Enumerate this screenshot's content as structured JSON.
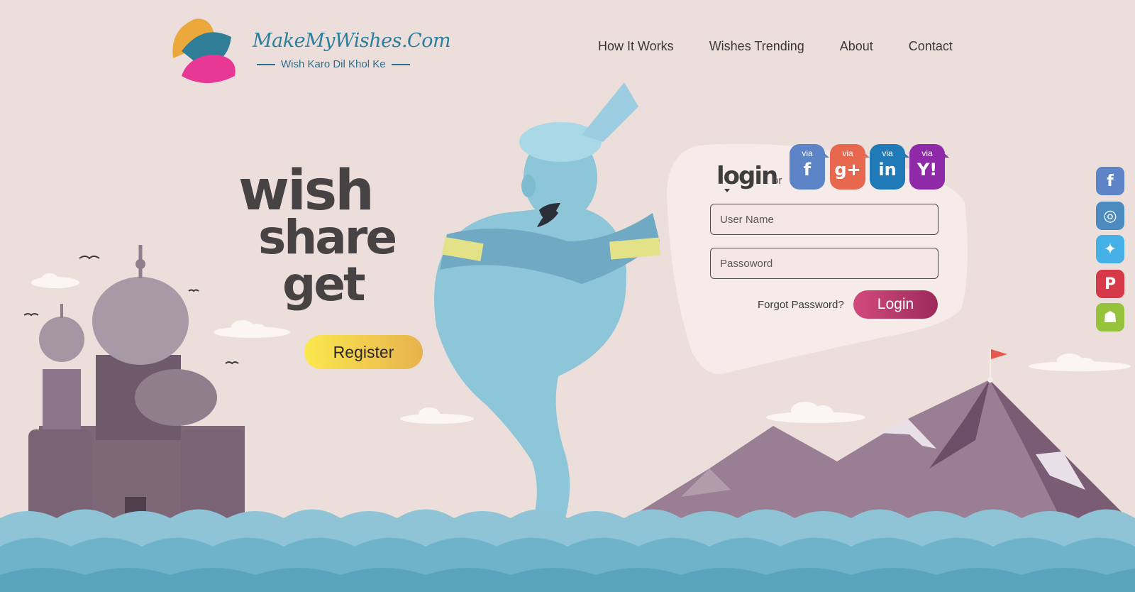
{
  "brand": {
    "title": "MakeMyWishes.Com",
    "tagline": "Wish Karo Dil Khol Ke"
  },
  "nav": {
    "items": [
      "How It Works",
      "Wishes Trending",
      "About",
      "Contact"
    ]
  },
  "hero": {
    "line1": "wish",
    "line2": "share",
    "line3": "get",
    "register_label": "Register"
  },
  "login": {
    "heading": "login",
    "or_label": "or",
    "social": [
      {
        "via": "via",
        "glyph": "f",
        "icon": "facebook-icon",
        "color": "#5c84c6"
      },
      {
        "via": "via",
        "glyph": "g+",
        "icon": "google-plus-icon",
        "color": "#e8684f"
      },
      {
        "via": "via",
        "glyph": "in",
        "icon": "linkedin-icon",
        "color": "#1f7ab7"
      },
      {
        "via": "via",
        "glyph": "Y!",
        "icon": "yahoo-icon",
        "color": "#8e2aa8"
      }
    ],
    "username_placeholder": "User Name",
    "password_placeholder": "Passoword",
    "forgot_label": "Forgot Password?",
    "submit_label": "Login"
  },
  "side_social": [
    {
      "icon": "facebook-icon",
      "glyph": "f",
      "color": "#5c84c6"
    },
    {
      "icon": "instagram-icon",
      "glyph": "◎",
      "color": "#4c8bc0"
    },
    {
      "icon": "twitter-icon",
      "glyph": "✦",
      "color": "#45b0e6"
    },
    {
      "icon": "pinterest-icon",
      "glyph": "P",
      "color": "#d63a48"
    },
    {
      "icon": "android-icon",
      "glyph": "☗",
      "color": "#96c23c"
    }
  ],
  "colors": {
    "background": "#ecdeda",
    "brand_teal": "#2d7f9e",
    "register_gradient": [
      "#fbe84e",
      "#e8b24e"
    ],
    "login_gradient": [
      "#d34a7d",
      "#9d2a5c"
    ],
    "water": "#6fb3ca",
    "genie": "#8cc6d8"
  }
}
